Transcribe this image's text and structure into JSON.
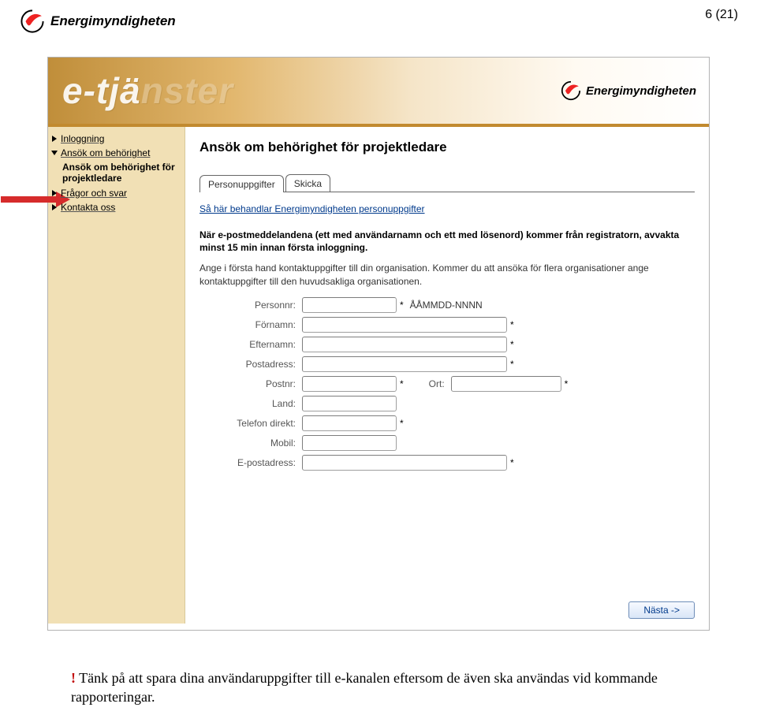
{
  "page_number": "6 (21)",
  "org_name": "Energimyndigheten",
  "banner": {
    "title_visible": "e-tjä",
    "title_faded": "nster",
    "logo_text": "Energimyndigheten"
  },
  "sidebar": {
    "items": [
      {
        "label": "Inloggning",
        "arrow": "right"
      },
      {
        "label": "Ansök om behörighet",
        "arrow": "down"
      },
      {
        "label": "Ansök om behörighet för projektledare",
        "arrow": "none",
        "active": true
      },
      {
        "label": "Frågor och svar",
        "arrow": "right"
      },
      {
        "label": "Kontakta oss",
        "arrow": "right"
      }
    ]
  },
  "main": {
    "heading": "Ansök om behörighet för projektledare",
    "tabs": [
      {
        "label": "Personuppgifter",
        "active": true
      },
      {
        "label": "Skicka",
        "active": false
      }
    ],
    "info_link": "Så här behandlar Energimyndigheten personuppgifter",
    "bold_note": "När e-postmeddelandena (ett med användarnamn och ett med lösenord) kommer från registratorn, avvakta minst 15 min innan första inloggning.",
    "plain_note": "Ange i första hand kontaktuppgifter till din organisation. Kommer du att ansöka för flera organisationer ange kontaktuppgifter till den huvudsakliga organisationen.",
    "fields": {
      "personnr_label": "Personnr:",
      "personnr_hint": "ÅÅMMDD-NNNN",
      "fornamn_label": "Förnamn:",
      "efternamn_label": "Efternamn:",
      "postadress_label": "Postadress:",
      "postnr_label": "Postnr:",
      "ort_label": "Ort:",
      "land_label": "Land:",
      "telefon_label": "Telefon direkt:",
      "mobil_label": "Mobil:",
      "epost_label": "E-postadress:"
    },
    "next_button": "Nästa ->"
  },
  "caption": {
    "exclaim": "!",
    "text": " Tänk på att spara dina användaruppgifter till e-kanalen eftersom de även ska användas vid kommande rapporteringar."
  }
}
